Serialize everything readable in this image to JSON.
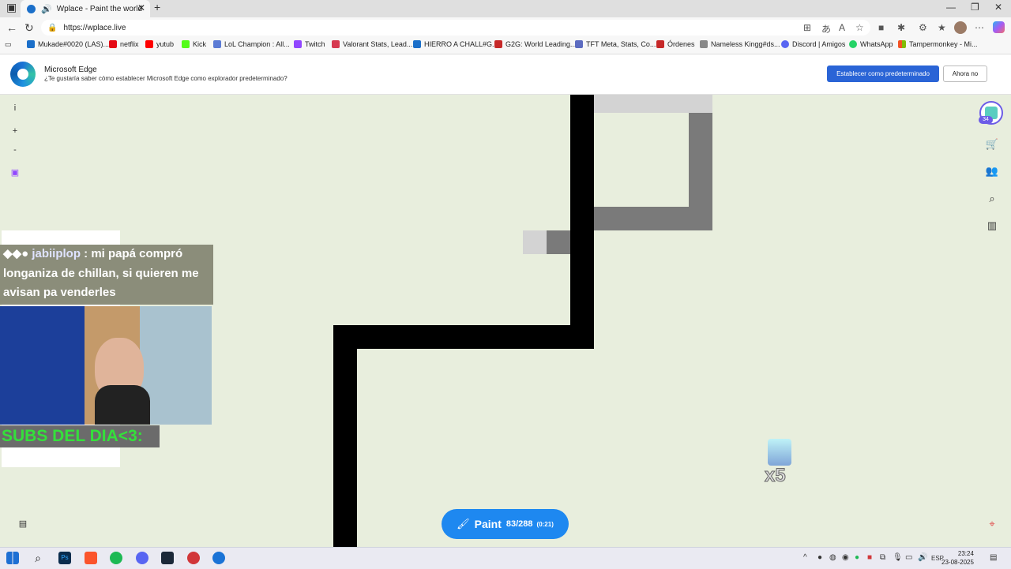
{
  "browser": {
    "tab_title": "Wplace - Paint the world",
    "url": "https://wplace.live",
    "bookmarks": [
      "Mukade#0020 (LAS)...",
      "netflix",
      "yutub",
      "Kick",
      "LoL Champion : All...",
      "Twitch",
      "Valorant Stats, Lead...",
      "HIERRO A CHALL#G...",
      "G2G: World Leading...",
      "TFT Meta, Stats, Co...",
      "Órdenes",
      "Nameless Kingg#ds...",
      "Discord | Amigos",
      "WhatsApp",
      "Tampermonkey - Mi..."
    ]
  },
  "infobar": {
    "title": "Microsoft Edge",
    "text": "¿Te gustaría saber cómo establecer Microsoft Edge como explorador predeterminado?",
    "primary_button": "Establecer como predeterminado",
    "secondary_button": "Ahora no"
  },
  "map_controls": {
    "info": "i",
    "zoom_in": "+",
    "zoom_out": "-",
    "user_level": "34"
  },
  "chat": {
    "user": "jabiiplop",
    "message": ": mi papá compró longaniza de chillan, si quieren me avisan pa venderles"
  },
  "overlay": {
    "subs_label": "SUBS DEL DIA<3:",
    "multiplier": "x5"
  },
  "paint": {
    "label": "Paint",
    "charges": "83/288",
    "timer": "(0:21)"
  },
  "taskbar": {
    "lang": "ESP",
    "time": "23:24",
    "date": "23-08-2025"
  },
  "colors": {
    "canvas_bg": "#e8eedd",
    "paint_button": "#1e88f0",
    "edge_primary": "#2a64d6"
  }
}
